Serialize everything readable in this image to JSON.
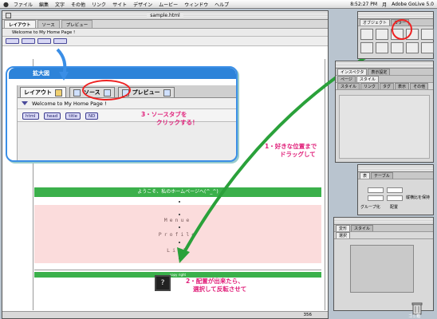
{
  "menubar": {
    "items": [
      "ファイル",
      "編集",
      "文字",
      "その他",
      "リンク",
      "サイト",
      "デザイン",
      "ムービー",
      "ウィンドウ",
      "ヘルプ"
    ],
    "clock": "8:52:27 PM",
    "day": "月",
    "app_name": "Adobe GoLive 5.0"
  },
  "document": {
    "title": "sample.html",
    "tabs": [
      "レイアウト",
      "ソース",
      "プレビュー"
    ],
    "page_title": "Welcome to My Home Page !",
    "zoom_readout": "356",
    "content": {
      "welcome_banner": "ようこそ、私のホームページへ(^_^)",
      "menu_items": [
        "Menue",
        "Profile",
        "Link"
      ],
      "footer_banner": "copy right"
    }
  },
  "zoom_callout": {
    "title": "拡大図",
    "tabs": [
      "レイアウト",
      "ソース",
      "プレビュー"
    ],
    "page_title": "Welcome to My Home Page !",
    "tags": [
      "html",
      "head",
      "title",
      "ND"
    ]
  },
  "annotations": {
    "step3": [
      "3・ソースタブを",
      "クリックする！"
    ],
    "step1": [
      "1・好きな位置まで",
      "ドラッグして"
    ],
    "step2": [
      "2・配置が出来たら、",
      "選択して反転させて"
    ]
  },
  "palettes": {
    "objects": {
      "tabs": [
        "オブジェクト",
        "カラー"
      ]
    },
    "inspector": {
      "tabs": [
        "インスペクタ",
        "表示設定"
      ],
      "subtabs": [
        "ページ",
        "スタイル"
      ],
      "subtab_row2": [
        "スタイル",
        "リンク",
        "タグ",
        "表示",
        "その他"
      ]
    },
    "table": {
      "tabs": [
        "表",
        "テーブル"
      ],
      "checkbox_label": "縦横比を保持",
      "align_label": "グループ化",
      "align_label2": "配置"
    },
    "transform": {
      "tabs": [
        "変形",
        "スタイル"
      ],
      "sub": "選択"
    }
  },
  "trash_label": "ゴミ箱",
  "colors": {
    "accent_blue": "#2d83d9",
    "annotation_pink": "#e0207a",
    "arrow_green": "#2aa13a",
    "red_marker": "#e22222",
    "banner_green": "#3bb04b"
  }
}
